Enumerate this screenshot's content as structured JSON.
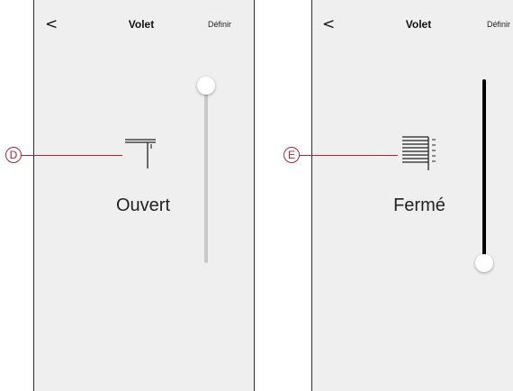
{
  "screens": [
    {
      "title": "Volet",
      "define_label": "Définir",
      "back_label": "<",
      "status_label": "Ouvert",
      "icon": "shutter-open-icon",
      "slider_level_percent": 100
    },
    {
      "title": "Volet",
      "define_label": "Définir",
      "back_label": "<",
      "status_label": "Fermé",
      "icon": "shutter-closed-icon",
      "slider_level_percent": 0
    }
  ],
  "callouts": [
    "D",
    "E"
  ],
  "colors": {
    "callout": "#b0243a",
    "track_inactive": "#c9c9c9",
    "track_active": "#000000",
    "screen_background": "#efefef"
  }
}
